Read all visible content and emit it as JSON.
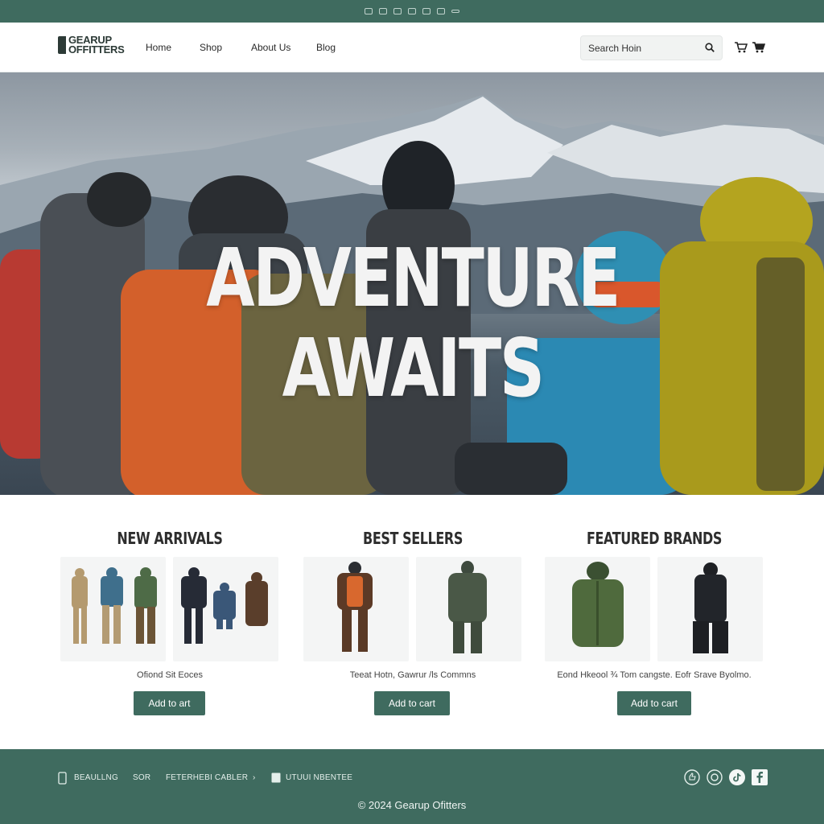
{
  "topbar": {
    "icons": [
      "instagram-icon",
      "youtube-icon",
      "email-icon",
      "map-icon",
      "chat-icon",
      "camera-icon",
      "phone-icon"
    ]
  },
  "header": {
    "logo_line1": "GEARUP",
    "logo_line2": "OFFITTERS",
    "nav": [
      "Home",
      "Shop",
      "About Us",
      "Blog"
    ],
    "search_placeholder": "Search Hoin",
    "cart_icons": [
      "cart-icon",
      "cart-icon"
    ]
  },
  "hero": {
    "title_line1": "ADVENTURE",
    "title_line2": "AWAITS"
  },
  "sections": [
    {
      "title": "NEW ARRIVALS",
      "caption": "Ofiond Sit Eoces",
      "button": "Add to art"
    },
    {
      "title": "BEST SELLERS",
      "caption": "Teeat Hotn, Gawrur /ls Commns",
      "button": "Add to cart"
    },
    {
      "title": "FEATURED BRANDS",
      "caption": "Eond Hkeool ¾ Tom cangste.  Eofr Srave Byolmo.",
      "button": "Add to cart"
    }
  ],
  "footer": {
    "links": [
      "BEAULLNG",
      "SOR",
      "FETERHEBI CABLER",
      "UTUUI NBENTEE"
    ],
    "copyright": "© 2024 Gearup Ofitters",
    "social": [
      "thumbs-icon",
      "instagram-icon",
      "tiktok-icon",
      "facebook-icon"
    ]
  },
  "colors": {
    "brand_green": "#3f6b5f",
    "text_dark": "#2d2d2d"
  }
}
